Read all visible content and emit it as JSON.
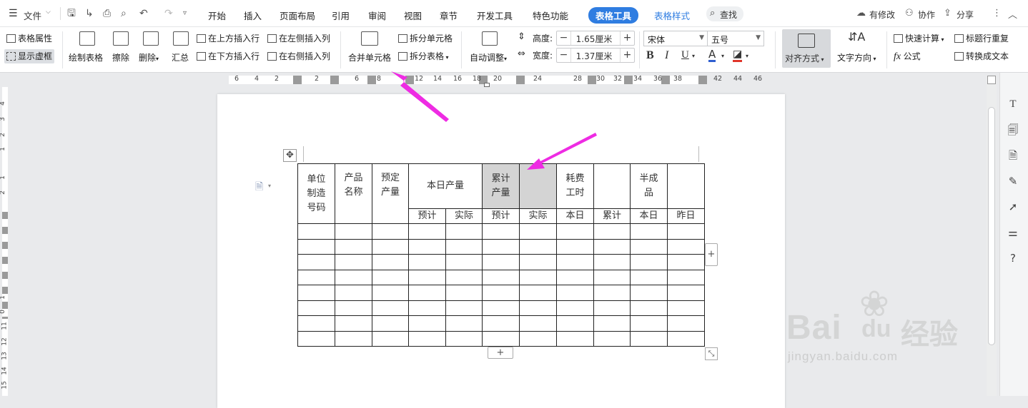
{
  "topbar": {
    "file_menu": "文件",
    "tabs": [
      "开始",
      "插入",
      "页面布局",
      "引用",
      "审阅",
      "视图",
      "章节",
      "开发工具",
      "特色功能"
    ],
    "active_tab": "表格工具",
    "context_tab": "表格样式",
    "search": "查找",
    "right": {
      "modified": "有修改",
      "collab": "协作",
      "share": "分享"
    }
  },
  "ribbon": {
    "table_props": "表格属性",
    "show_gridlines": "显示虚框",
    "draw_table": "绘制表格",
    "erase": "擦除",
    "delete": "删除",
    "summary": "汇总",
    "insert_row_above": "在上方插入行",
    "insert_row_below": "在下方插入行",
    "insert_col_left": "在左侧插入列",
    "insert_col_right": "在右侧插入列",
    "merge_cells": "合并单元格",
    "split_cells": "拆分单元格",
    "split_table": "拆分表格",
    "auto_fit": "自动调整",
    "height_label": "高度:",
    "height_value": "1.65厘米",
    "width_label": "宽度:",
    "width_value": "1.37厘米",
    "font_name": "宋体",
    "font_size": "五号",
    "align": "对齐方式",
    "text_direction": "文字方向",
    "quick_calc": "快速计算",
    "formula": "公式",
    "repeat_header": "标题行重复",
    "convert_text": "转换成文本"
  },
  "ruler": {
    "h_ticks": [
      "6",
      "4",
      "2",
      "2",
      "6",
      "8",
      "12",
      "14",
      "16",
      "18",
      "20",
      "24",
      "28",
      "30",
      "32",
      "34",
      "36",
      "38",
      "42",
      "44",
      "46"
    ],
    "v_ticks": [
      "4",
      "3",
      "2",
      "1",
      "1",
      "2",
      "1",
      "0",
      "11",
      "12",
      "13",
      "14",
      "15"
    ]
  },
  "table": {
    "header_row1": {
      "unit_code": "单位制造号码",
      "product_name": "产品名称",
      "planned_output": "预定产量",
      "daily_output": "本日产量",
      "cumulative_output": "累计产量",
      "hours": "耗费工时",
      "semi_finished": "半成品"
    },
    "header_row2": [
      "预计",
      "实际",
      "预计",
      "实际",
      "本日",
      "累计",
      "本日",
      "昨日"
    ]
  },
  "watermark": {
    "brand": "Bai",
    "brand2": "du",
    "cn": "经验",
    "url": "jingyan.baidu.com"
  }
}
